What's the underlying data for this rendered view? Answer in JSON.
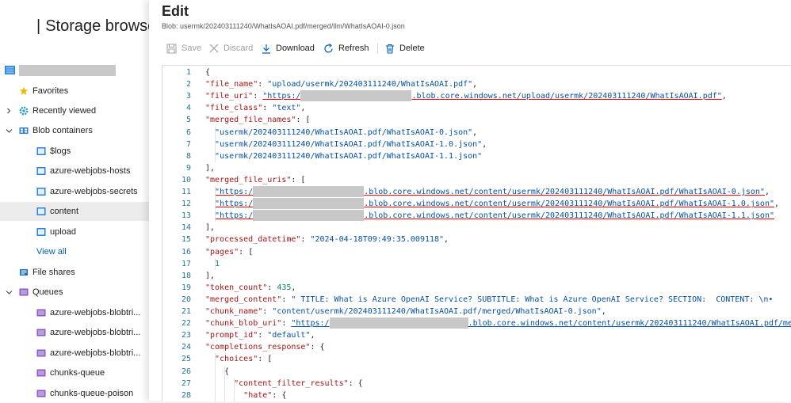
{
  "left": {
    "title": "Storage browse",
    "tree": [
      {
        "key": "favorites",
        "label": "Favorites",
        "chevron": "",
        "icon": "star-icon",
        "indent": 0
      },
      {
        "key": "recent",
        "label": "Recently viewed",
        "chevron": "›",
        "icon": "gear-icon",
        "indent": 0
      },
      {
        "key": "blob",
        "label": "Blob containers",
        "chevron": "⌄",
        "icon": "blob-icon",
        "indent": 0
      },
      {
        "key": "logs",
        "label": "$logs",
        "chevron": "",
        "icon": "container-icon",
        "indent": 1
      },
      {
        "key": "hosts",
        "label": "azure-webjobs-hosts",
        "chevron": "",
        "icon": "container-icon",
        "indent": 1
      },
      {
        "key": "secrets",
        "label": "azure-webjobs-secrets",
        "chevron": "",
        "icon": "container-icon",
        "indent": 1
      },
      {
        "key": "content",
        "label": "content",
        "chevron": "",
        "icon": "container-icon",
        "indent": 1,
        "selected": true
      },
      {
        "key": "upload",
        "label": "upload",
        "chevron": "",
        "icon": "container-icon",
        "indent": 1
      },
      {
        "key": "viewall",
        "label": "View all",
        "chevron": "",
        "icon": "",
        "indent": 1,
        "link": true
      },
      {
        "key": "files",
        "label": "File shares",
        "chevron": "",
        "icon": "file-share-icon",
        "indent": 0
      },
      {
        "key": "queues",
        "label": "Queues",
        "chevron": "⌄",
        "icon": "queue-icon",
        "indent": 0
      },
      {
        "key": "q1",
        "label": "azure-webjobs-blobtri...",
        "chevron": "",
        "icon": "queue-item-icon",
        "indent": 1
      },
      {
        "key": "q2",
        "label": "azure-webjobs-blobtri...",
        "chevron": "",
        "icon": "queue-item-icon",
        "indent": 1
      },
      {
        "key": "q3",
        "label": "azure-webjobs-blobtri...",
        "chevron": "",
        "icon": "queue-item-icon",
        "indent": 1
      },
      {
        "key": "q4",
        "label": "chunks-queue",
        "chevron": "",
        "icon": "queue-item-icon",
        "indent": 1
      },
      {
        "key": "q5",
        "label": "chunks-queue-poison",
        "chevron": "",
        "icon": "queue-item-icon",
        "indent": 1
      }
    ]
  },
  "editor": {
    "title": "Edit",
    "blob_path": "Blob: usermk/202403111240/WhatIsAOAI.pdf/merged/llm/WhatIsAOAI-0.json",
    "toolbar": {
      "save": "Save",
      "discard": "Discard",
      "download": "Download",
      "refresh": "Refresh",
      "delete": "Delete"
    },
    "lines": [
      [
        [
          "p",
          "{"
        ]
      ],
      [
        [
          "k",
          "\"file_name\""
        ],
        [
          "p",
          ": "
        ],
        [
          "s",
          "\"upload/usermk/202403111240/WhatIsAOAI.pdf\""
        ],
        [
          "p",
          ","
        ]
      ],
      [
        [
          "k",
          "\"file_uri\""
        ],
        [
          "p",
          ": "
        ],
        [
          "su",
          "\"https:/"
        ],
        [
          "r",
          ""
        ],
        [
          "su",
          ".blob.core.windows.net/upload/usermk/202403111240/WhatIsAOAI.pdf\""
        ],
        [
          "p",
          ","
        ]
      ],
      [
        [
          "k",
          "\"file_class\""
        ],
        [
          "p",
          ": "
        ],
        [
          "s",
          "\"text\""
        ],
        [
          "p",
          ","
        ]
      ],
      [
        [
          "k",
          "\"merged_file_names\""
        ],
        [
          "p",
          ": ["
        ]
      ],
      [
        [
          "p",
          "  "
        ],
        [
          "s",
          "\"usermk/202403111240/WhatIsAOAI.pdf/WhatIsAOAI-0.json\""
        ],
        [
          "p",
          ","
        ]
      ],
      [
        [
          "p",
          "  "
        ],
        [
          "s",
          "\"usermk/202403111240/WhatIsAOAI.pdf/WhatIsAOAI-1.0.json\""
        ],
        [
          "p",
          ","
        ]
      ],
      [
        [
          "p",
          "  "
        ],
        [
          "s",
          "\"usermk/202403111240/WhatIsAOAI.pdf/WhatIsAOAI-1.1.json\""
        ]
      ],
      [
        [
          "p",
          "],"
        ]
      ],
      [
        [
          "k",
          "\"merged_file_uris\""
        ],
        [
          "p",
          ": ["
        ]
      ],
      [
        [
          "p",
          "  "
        ],
        [
          "su",
          "\"https:/"
        ],
        [
          "r",
          ""
        ],
        [
          "su",
          ".blob.core.windows.net/content/usermk/202403111240/WhatIsAOAI.pdf/WhatIsAOAI-0.json\""
        ],
        [
          "p",
          ","
        ]
      ],
      [
        [
          "p",
          "  "
        ],
        [
          "su",
          "\"https:/"
        ],
        [
          "r",
          ""
        ],
        [
          "su",
          ".blob.core.windows.net/content/usermk/202403111240/WhatIsAOAI.pdf/WhatIsAOAI-1.0.json\""
        ],
        [
          "p",
          ","
        ]
      ],
      [
        [
          "p",
          "  "
        ],
        [
          "su",
          "\"https:/"
        ],
        [
          "r",
          ""
        ],
        [
          "su",
          ".blob.core.windows.net/content/usermk/202403111240/WhatIsAOAI.pdf/WhatIsAOAI-1.1.json\""
        ]
      ],
      [
        [
          "p",
          "],"
        ]
      ],
      [
        [
          "k",
          "\"processed_datetime\""
        ],
        [
          "p",
          ": "
        ],
        [
          "s",
          "\"2024-04-18T09:49:35.009118\""
        ],
        [
          "p",
          ","
        ]
      ],
      [
        [
          "k",
          "\"pages\""
        ],
        [
          "p",
          ": ["
        ]
      ],
      [
        [
          "p",
          "  "
        ],
        [
          "n",
          "1"
        ]
      ],
      [
        [
          "p",
          "],"
        ]
      ],
      [
        [
          "k",
          "\"token_count\""
        ],
        [
          "p",
          ": "
        ],
        [
          "n",
          "435"
        ],
        [
          "p",
          ","
        ]
      ],
      [
        [
          "k",
          "\"merged_content\""
        ],
        [
          "p",
          ": "
        ],
        [
          "s",
          "\" TITLE: What is Azure OpenAI Service? SUBTITLE: What is Azure OpenAI Service? SECTION:  CONTENT: \\n•"
        ]
      ],
      [
        [
          "k",
          "\"chunk_name\""
        ],
        [
          "p",
          ": "
        ],
        [
          "s",
          "\"content/usermk/202403111240/WhatIsAOAI.pdf/merged/WhatIsAOAI-0.json\""
        ],
        [
          "p",
          ","
        ]
      ],
      [
        [
          "k",
          "\"chunk_blob_uri\""
        ],
        [
          "p",
          ": "
        ],
        [
          "su2",
          "\"https:/"
        ],
        [
          "r",
          ""
        ],
        [
          "su2",
          ".blob.core.windows.net/content/usermk/202403111240/WhatIsAOAI.pdf/merg"
        ]
      ],
      [
        [
          "k",
          "\"prompt_id\""
        ],
        [
          "p",
          ": "
        ],
        [
          "s",
          "\"default\""
        ],
        [
          "p",
          ","
        ]
      ],
      [
        [
          "k",
          "\"completions_response\""
        ],
        [
          "p",
          ": {"
        ]
      ],
      [
        [
          "p",
          "  "
        ],
        [
          "k",
          "\"choices\""
        ],
        [
          "p",
          ": ["
        ]
      ],
      [
        [
          "p",
          "    {"
        ]
      ],
      [
        [
          "p",
          "      "
        ],
        [
          "k",
          "\"content_filter_results\""
        ],
        [
          "p",
          ": {"
        ]
      ],
      [
        [
          "p",
          "        "
        ],
        [
          "k",
          "\"hate\""
        ],
        [
          "p",
          ": {"
        ]
      ]
    ],
    "line_numbers": [
      "1",
      "2",
      "3",
      "4",
      "5",
      "6",
      "7",
      "8",
      "9",
      "10",
      "11",
      "12",
      "13",
      "14",
      "15",
      "16",
      "17",
      "18",
      "19",
      "20",
      "21",
      "22",
      "23",
      "24",
      "25",
      "26",
      "27",
      "28"
    ]
  },
  "colors": {
    "key": "#a31515",
    "string": "#0451a5",
    "number": "#098658",
    "line_number": "#237893",
    "accent": "#0062b8",
    "redaction": "#c8c8c8"
  }
}
